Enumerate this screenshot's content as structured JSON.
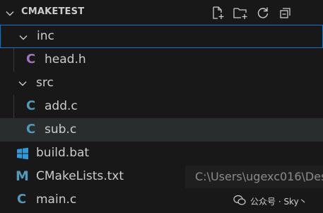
{
  "explorer": {
    "title": "CMAKETEST",
    "actions": [
      {
        "icon": "new-file-icon"
      },
      {
        "icon": "new-folder-icon"
      },
      {
        "icon": "refresh-icon"
      },
      {
        "icon": "collapse-all-icon"
      }
    ]
  },
  "tree": {
    "inc": {
      "label": "inc",
      "icon": "chevron-down-icon"
    },
    "head_h": {
      "label": "head.h",
      "icon_letter": "C",
      "icon_color": "#a074c4"
    },
    "src": {
      "label": "src",
      "icon": "chevron-down-icon"
    },
    "add_c": {
      "label": "add.c",
      "icon_letter": "C",
      "icon_color": "#519aba"
    },
    "sub_c": {
      "label": "sub.c",
      "icon_letter": "C",
      "icon_color": "#519aba"
    },
    "build_bat": {
      "label": "build.bat",
      "icon": "windows-icon",
      "icon_color": "#2f9ad8"
    },
    "cmakelists": {
      "label": "CMakeLists.txt",
      "icon_letter": "M",
      "icon_color": "#519aba"
    },
    "main_c": {
      "label": "main.c",
      "icon_letter": "C",
      "icon_color": "#519aba"
    }
  },
  "overlay": {
    "path_hint": "C:\\Users\\ugexc016\\Des",
    "watermark": "公众号 · Sky丶"
  },
  "colors": {
    "background": "#181818",
    "selection_border": "#0078d4",
    "hover_row": "#2a2d2e",
    "text": "#cccccc"
  }
}
